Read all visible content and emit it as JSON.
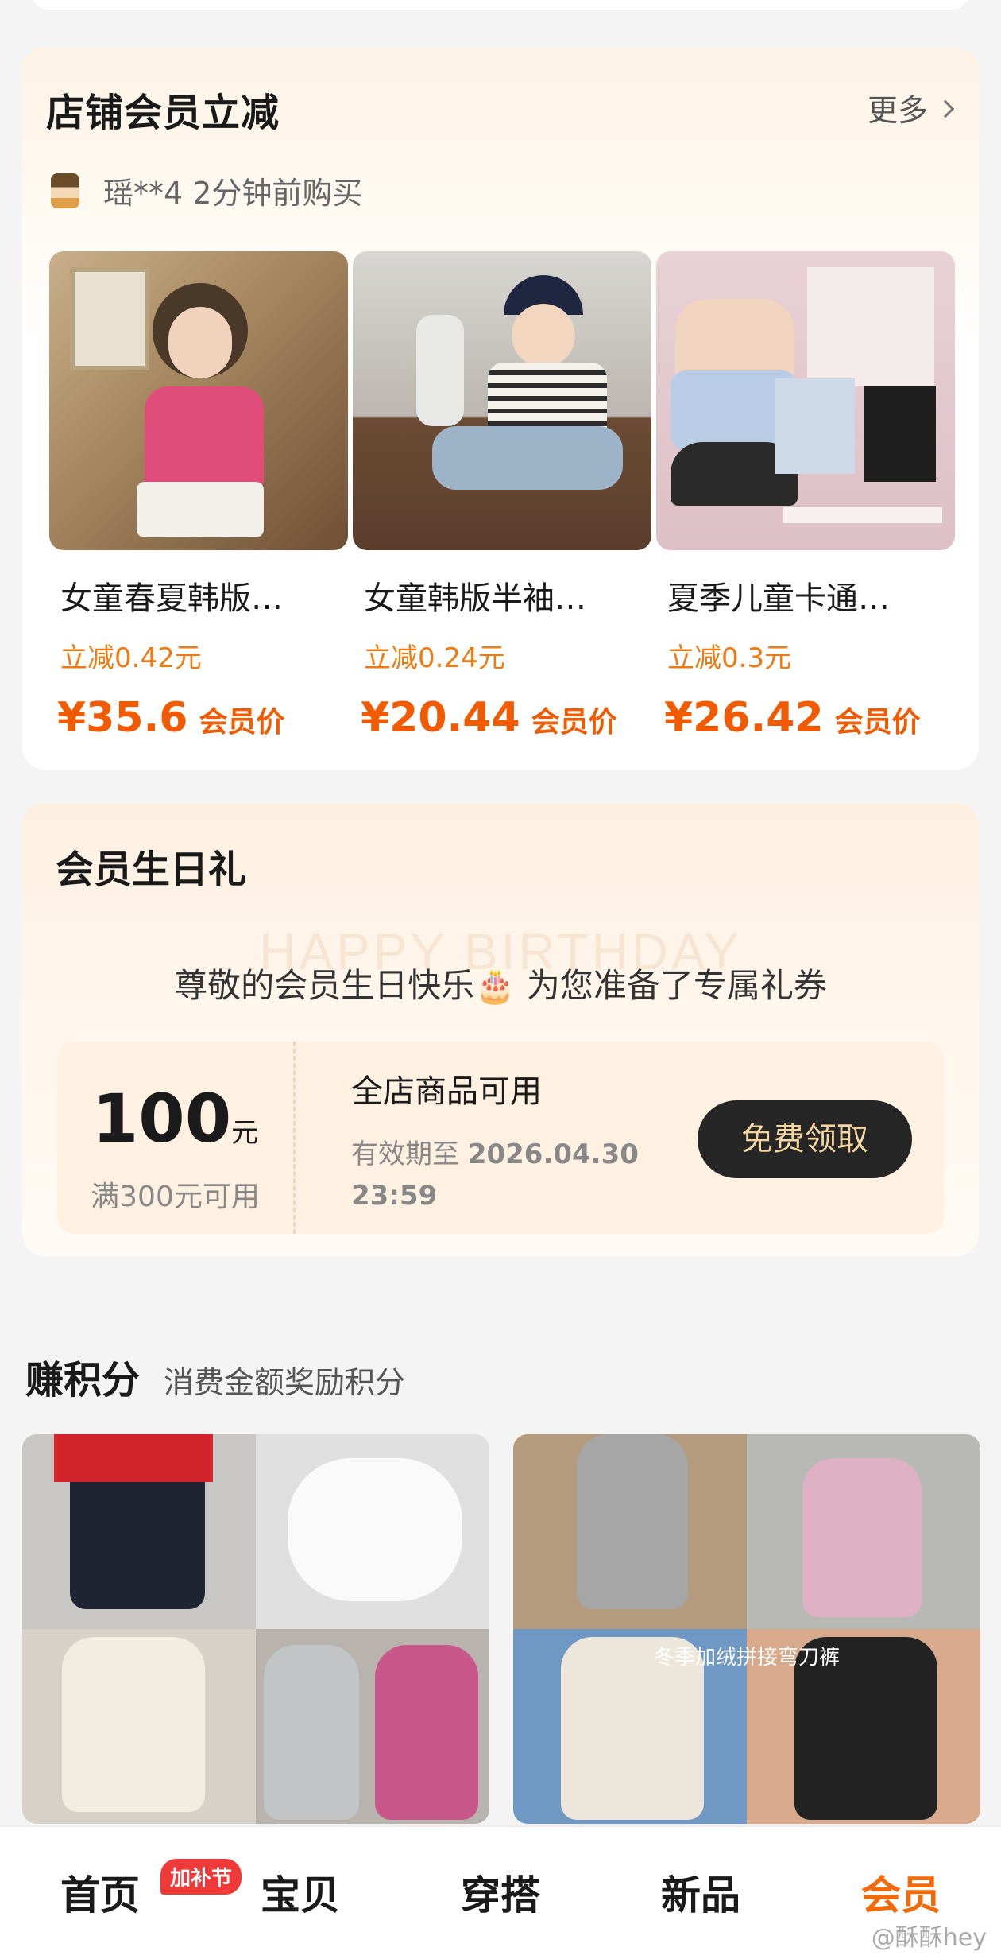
{
  "discount_section": {
    "title": "店铺会员立减",
    "more_label": "更多",
    "recent_buyer": "瑶**4 2分钟前购买",
    "products": [
      {
        "name": "女童春夏韩版…",
        "discount": "立减0.42元",
        "price": "¥35.6",
        "price_tag": "会员价"
      },
      {
        "name": "女童韩版半袖…",
        "discount": "立减0.24元",
        "price": "¥20.44",
        "price_tag": "会员价"
      },
      {
        "name": "夏季儿童卡通…",
        "discount": "立减0.3元",
        "price": "¥26.42",
        "price_tag": "会员价"
      }
    ]
  },
  "birthday_section": {
    "title": "会员生日礼",
    "watermark": "HAPPY BIRTHDAY",
    "message": "尊敬的会员生日快乐🎂 为您准备了专属礼券",
    "coupon": {
      "amount": "100",
      "unit": "元",
      "condition": "满300元可用",
      "scope": "全店商品可用",
      "validity_label": "有效期至",
      "validity_date": "2026.04.30",
      "validity_time": "23:59",
      "button_label": "免费领取"
    }
  },
  "points_section": {
    "title": "赚积分",
    "subtitle": "消费金额奖励积分",
    "image_captions": [
      "冬季加绒拼接弯刀裤"
    ]
  },
  "bottom_nav": {
    "items": [
      {
        "label": "首页",
        "active": false
      },
      {
        "label": "宝贝",
        "active": false
      },
      {
        "label": "穿搭",
        "active": false
      },
      {
        "label": "新品",
        "active": false
      },
      {
        "label": "会员",
        "active": true
      }
    ],
    "badge": "加补节"
  },
  "corner_watermark": "@酥酥hey",
  "colors": {
    "accent": "#f25a00",
    "discount_text": "#f27a10",
    "button_bg": "#262626",
    "button_text": "#f5d5a0"
  }
}
